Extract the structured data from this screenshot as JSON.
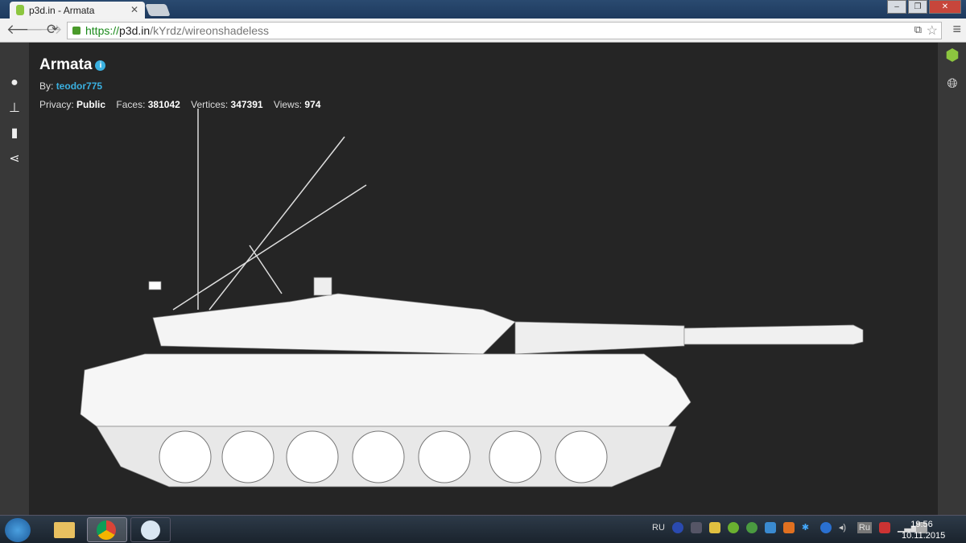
{
  "browser": {
    "tab_title": "p3d.in - Armata",
    "tab_close": "✕",
    "url_scheme": "https://",
    "url_host": "p3d.in",
    "url_path": "/kYrdz/wireonshadeless",
    "window_min": "–",
    "window_max": "❐",
    "window_close": "✕"
  },
  "model": {
    "title": "Armata",
    "info": "i",
    "by_label": "By:",
    "author": "teodor775",
    "privacy_label": "Privacy:",
    "privacy": "Public",
    "faces_label": "Faces:",
    "faces": "381042",
    "vertices_label": "Vertices:",
    "vertices": "347391",
    "views_label": "Views:",
    "views": "974"
  },
  "left_sidebar": [
    "lighting-icon",
    "pan-icon",
    "mouse-icon",
    "share-icon"
  ],
  "right_sidebar": [
    "p3d-logo",
    "globe-icon"
  ],
  "taskbar": {
    "lang": "RU",
    "tray_lang": "Ru",
    "time": "19:56",
    "date": "10.11.2015"
  }
}
